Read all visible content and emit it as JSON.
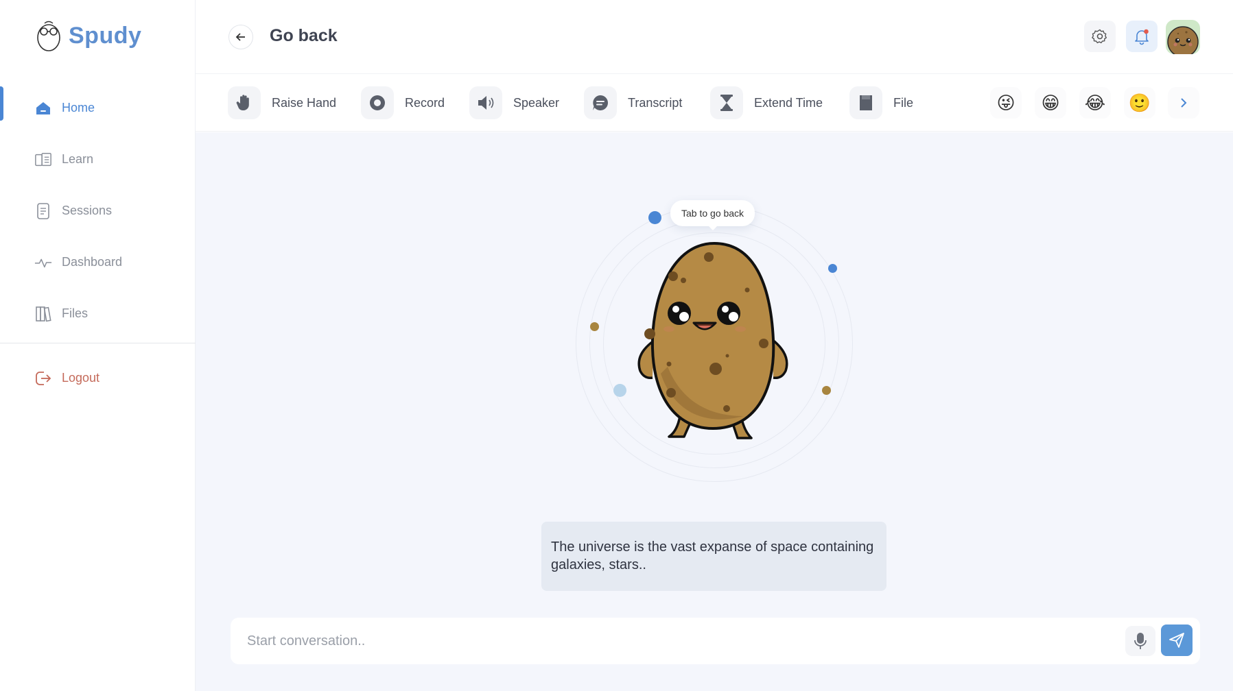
{
  "brand": {
    "name": "Spudy",
    "logo_icon": "potato-glasses-logo-icon"
  },
  "sidebar": {
    "items": [
      {
        "label": "Home",
        "icon": "home-icon",
        "active": true
      },
      {
        "label": "Learn",
        "icon": "book-icon",
        "active": false
      },
      {
        "label": "Sessions",
        "icon": "document-icon",
        "active": false
      },
      {
        "label": "Dashboard",
        "icon": "activity-icon",
        "active": false
      },
      {
        "label": "Files",
        "icon": "files-icon",
        "active": false
      }
    ],
    "logout": {
      "label": "Logout",
      "icon": "logout-icon"
    }
  },
  "header": {
    "title": "Go back",
    "back_icon": "arrow-left-icon",
    "settings_icon": "gear-icon",
    "notifications_icon": "bell-icon",
    "has_notification": true
  },
  "toolbar": {
    "tools": [
      {
        "label": "Raise Hand",
        "icon": "hand-icon"
      },
      {
        "label": "Record",
        "icon": "record-icon"
      },
      {
        "label": "Speaker",
        "icon": "speaker-icon"
      },
      {
        "label": "Transcript",
        "icon": "chat-bubble-icon"
      },
      {
        "label": "Extend Time",
        "icon": "hourglass-icon"
      },
      {
        "label": "File",
        "icon": "file-icon"
      }
    ],
    "emojis": [
      "😜",
      "😁",
      "😂",
      "🙂"
    ],
    "more_icon": "chevron-right-icon"
  },
  "stage": {
    "tooltip": "Tab to go back",
    "message": "The universe is the vast expanse of space containing galaxies, stars.."
  },
  "composer": {
    "placeholder": "Start conversation..",
    "value": "",
    "mic_icon": "microphone-icon",
    "send_icon": "send-icon"
  },
  "colors": {
    "accent": "#4a86d4",
    "brand": "#5f8fcf",
    "logout": "#c46a5a",
    "stage_bg": "#f4f6fc",
    "message_bg": "#e5eaf2",
    "send_bg": "#5b98d8",
    "potato": "#b58a45"
  }
}
